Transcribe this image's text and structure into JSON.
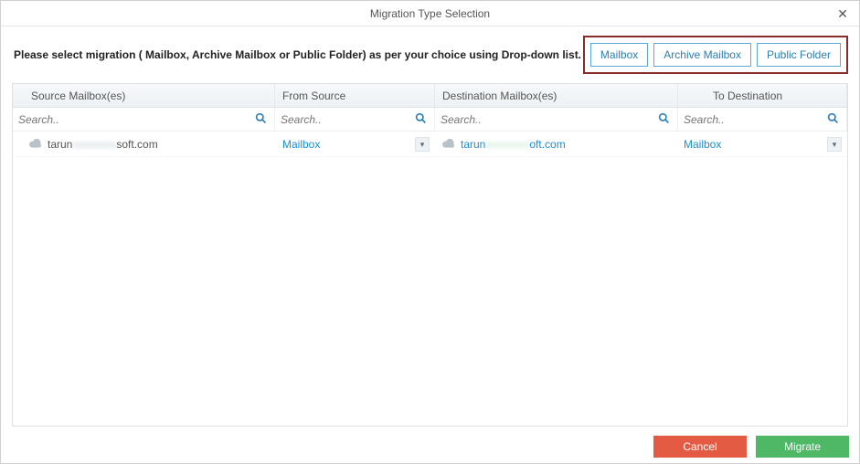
{
  "window": {
    "title": "Migration Type Selection",
    "close": "✕"
  },
  "instruction": "Please select migration ( Mailbox, Archive Mailbox or Public Folder) as per your choice using Drop-down list.",
  "typeButtons": {
    "mailbox": "Mailbox",
    "archive": "Archive Mailbox",
    "public": "Public Folder"
  },
  "columns": {
    "sourceMailboxes": "Source Mailbox(es)",
    "fromSource": "From Source",
    "destMailboxes": "Destination Mailbox(es)",
    "toDestination": "To Destination"
  },
  "search": {
    "placeholder": "Search.."
  },
  "row": {
    "sourceMailPrefix": "tarun",
    "sourceMailHidden": "xxxxxxxx",
    "sourceMailSuffix": "soft.com",
    "fromSource": "Mailbox",
    "destMailPrefix": "tarun",
    "destMailHidden": "xxxxxxxx",
    "destMailSuffix": "oft.com",
    "toDestination": "Mailbox"
  },
  "footer": {
    "cancel": "Cancel",
    "migrate": "Migrate"
  }
}
